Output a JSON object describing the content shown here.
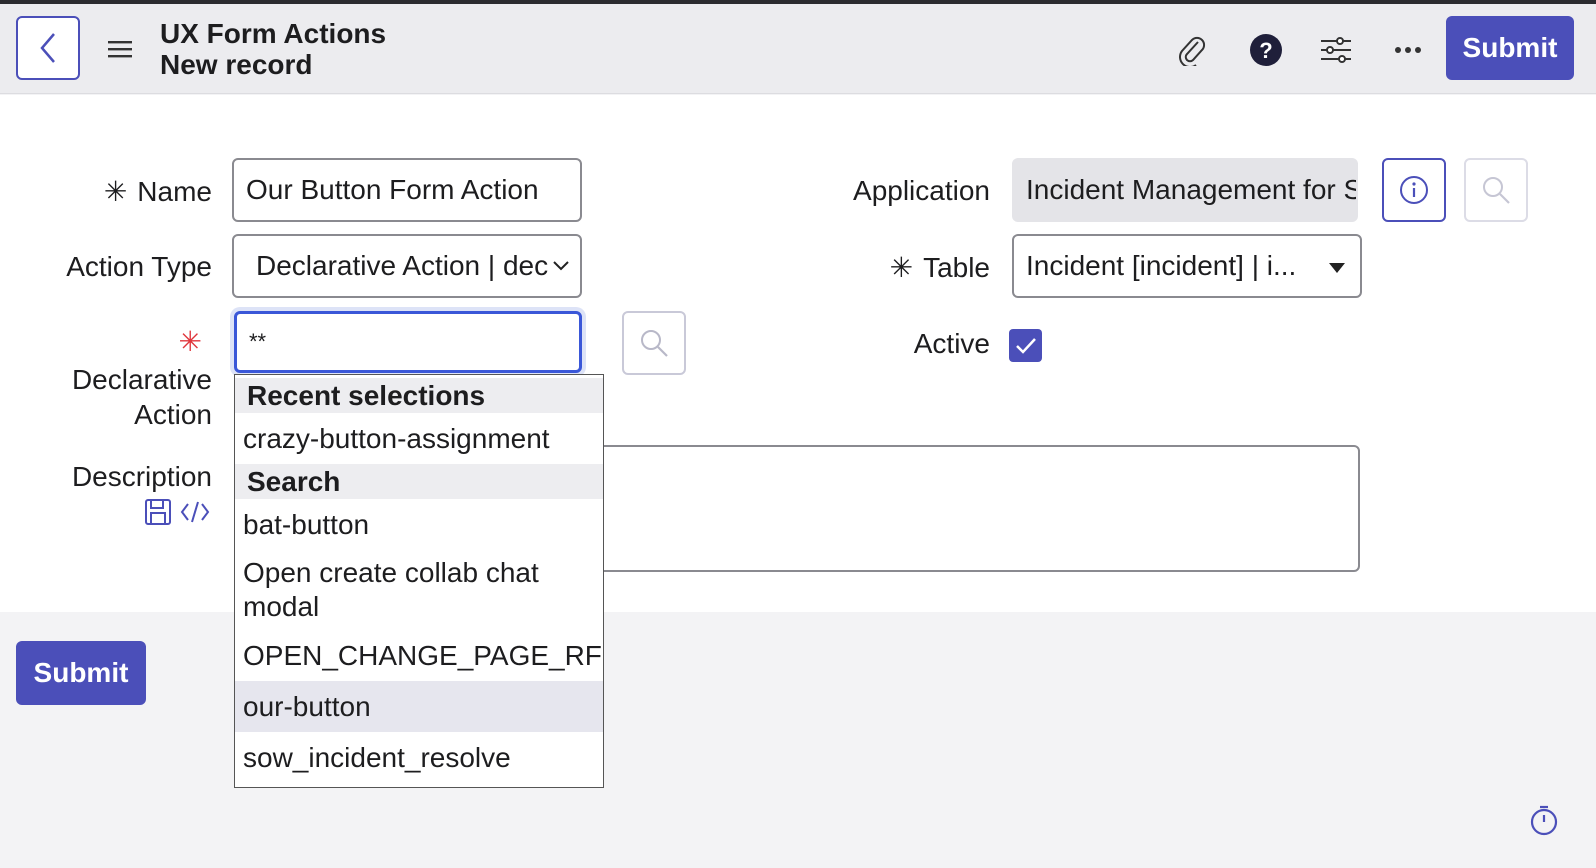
{
  "header": {
    "title": "UX Form Actions",
    "subtitle": "New record",
    "submit_label": "Submit",
    "icons": [
      "back-icon",
      "menu-icon",
      "paperclip-icon",
      "help-icon",
      "sliders-icon",
      "more-icon"
    ]
  },
  "form": {
    "name": {
      "label": "Name",
      "value": "Our Button Form Action",
      "required": true
    },
    "action_type": {
      "label": "Action Type",
      "value": "Declarative Action | dec"
    },
    "declarative_action": {
      "label_line1": "Declarative",
      "label_line2": "Action",
      "value": "**",
      "required": true
    },
    "description": {
      "label": "Description",
      "value": ""
    },
    "application": {
      "label": "Application",
      "value": "Incident Management for S"
    },
    "table": {
      "label": "Table",
      "value": "Incident [incident] | i...",
      "required": true
    },
    "active": {
      "label": "Active",
      "checked": true
    },
    "required_mark": "✳"
  },
  "dropdown": {
    "recent_header": "Recent selections",
    "recent_items": [
      "crazy-button-assignment"
    ],
    "search_header": "Search",
    "search_items": [
      "bat-button",
      "Open create collab chat modal",
      "OPEN_CHANGE_PAGE_RFC",
      "our-button",
      "sow_incident_resolve"
    ],
    "highlighted_index": 3
  },
  "footer": {
    "submit_label": "Submit"
  },
  "colors": {
    "accent": "#4b4fb9",
    "required": "#e0363c",
    "focus": "#3a57d8"
  }
}
